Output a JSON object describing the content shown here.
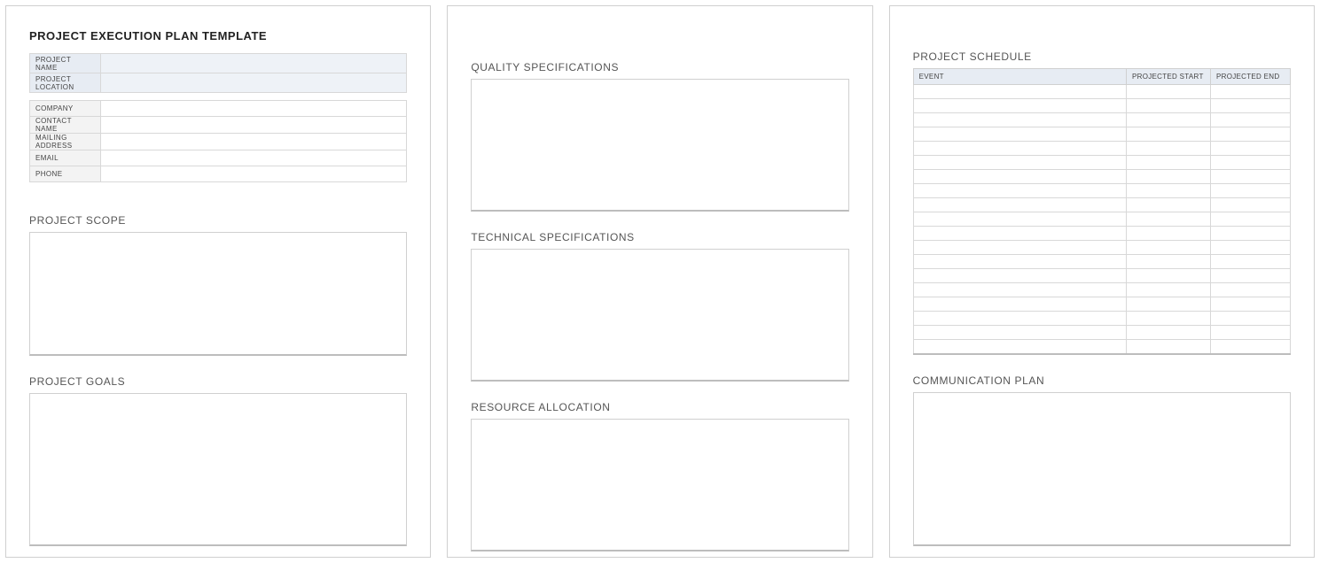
{
  "page1": {
    "title": "PROJECT EXECUTION PLAN TEMPLATE",
    "header_rows": [
      {
        "label": "PROJECT NAME",
        "value": ""
      },
      {
        "label": "PROJECT LOCATION",
        "value": ""
      }
    ],
    "info_rows": [
      {
        "label": "COMPANY",
        "value": ""
      },
      {
        "label": "CONTACT NAME",
        "value": ""
      },
      {
        "label": "MAILING ADDRESS",
        "value": ""
      },
      {
        "label": "EMAIL",
        "value": ""
      },
      {
        "label": "PHONE",
        "value": ""
      }
    ],
    "scope_heading": "PROJECT SCOPE",
    "goals_heading": "PROJECT GOALS"
  },
  "page2": {
    "quality_heading": "QUALITY SPECIFICATIONS",
    "technical_heading": "TECHNICAL SPECIFICATIONS",
    "resource_heading": "RESOURCE ALLOCATION"
  },
  "page3": {
    "schedule_heading": "PROJECT SCHEDULE",
    "schedule_columns": {
      "event": "EVENT",
      "start": "PROJECTED START",
      "end": "PROJECTED END"
    },
    "schedule_rows": 19,
    "comm_heading": "COMMUNICATION PLAN"
  }
}
